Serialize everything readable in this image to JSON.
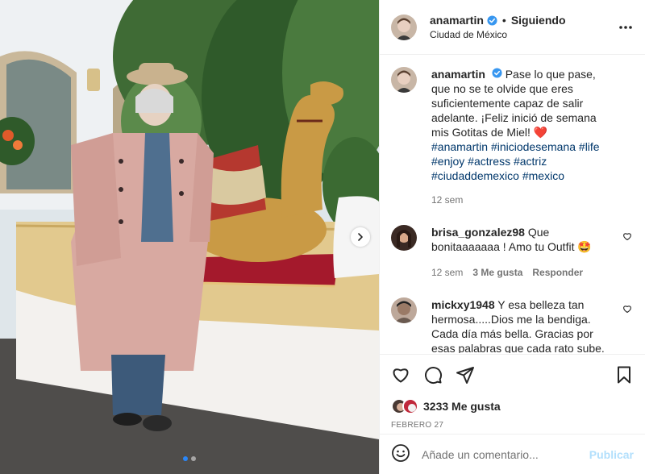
{
  "post": {
    "image_alt": "Woman in pink trench coat and hat next to a decorative camel",
    "carousel": {
      "total": 2,
      "current": 1
    }
  },
  "header": {
    "username": "anamartin",
    "separator": "•",
    "follow_label": "Siguiendo",
    "location": "Ciudad de México"
  },
  "caption": {
    "username": "anamartin",
    "text": "Pase lo que pase, que no se te olvide que eres suficientemente capaz de salir adelante. ¡Feliz inició de semana mis Gotitas de Miel!",
    "emoji": "❤️",
    "hashtags": [
      "#anamartin",
      "#iniciodesemana",
      "#life",
      "#enjoy",
      "#actress",
      "#actriz",
      "#ciudaddemexico",
      "#mexico"
    ],
    "time": "12 sem"
  },
  "comments": [
    {
      "username": "brisa_gonzalez98",
      "text": "Que bonitaaaaaaa ! Amo tu Outfit 🤩",
      "time": "12 sem",
      "likes": "3 Me gusta",
      "reply": "Responder"
    },
    {
      "username": "mickxy1948",
      "text": "Y esa belleza tan hermosa.....Dios me la bendiga. Cada día más bella. Gracias por esas palabras que cada rato sube. Siempre llegan donde mi cuando más las necesito."
    }
  ],
  "actions": {
    "like_icon": "heart-icon",
    "comment_icon": "comment-icon",
    "share_icon": "share-icon",
    "save_icon": "bookmark-icon"
  },
  "likes": {
    "count_label": "3233 Me gusta"
  },
  "date": "FEBRERO 27",
  "composer": {
    "placeholder": "Añade un comentario...",
    "publish_label": "Publicar",
    "emoji_icon": "smiley-icon"
  },
  "colors": {
    "verified": "#3897f0",
    "heart_red": "#ed4956",
    "hashtag": "#00376b",
    "secondary_text": "#737373",
    "publish_disabled": "#b2dffc",
    "carousel_dot_active": "#2a86f7"
  }
}
